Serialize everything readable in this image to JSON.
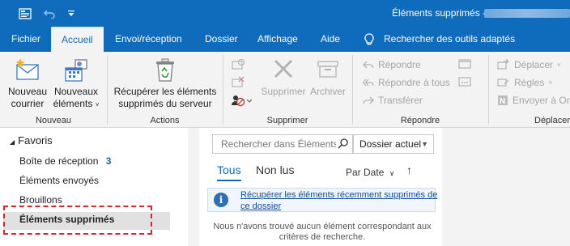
{
  "titlebar": {
    "title": "Éléments supprimés - ",
    "icons": [
      "outlook-sync-icon",
      "undo-icon",
      "qat-customize-icon"
    ]
  },
  "tabs": [
    {
      "label": "Fichier"
    },
    {
      "label": "Accueil",
      "active": true
    },
    {
      "label": "Envoi/réception"
    },
    {
      "label": "Dossier"
    },
    {
      "label": "Affichage"
    },
    {
      "label": "Aide"
    }
  ],
  "tell_me": {
    "label": "Rechercher des outils adaptés",
    "icon": "lightbulb-icon"
  },
  "ribbon": {
    "nouveau": {
      "new_mail": "Nouveau\ncourrier",
      "new_items": "Nouveaux\néléments",
      "group_label": "Nouveau"
    },
    "actions": {
      "recover": "Récupérer les éléments\nsupprimés du serveur",
      "group_label": "Actions"
    },
    "supprimer": {
      "delete": "Supprimer",
      "archive": "Archiver",
      "group_label": "Supprimer"
    },
    "repondre": {
      "reply": "Répondre",
      "reply_all": "Répondre à tous",
      "forward": "Transférer",
      "group_label": "Répondre"
    },
    "deplacer": {
      "move": "Déplacer",
      "rules": "Règles",
      "send_onenote": "Envoyer à On",
      "group_label": "Déplacer"
    }
  },
  "nav": {
    "header": "Favoris",
    "items": [
      {
        "label": "Boîte de réception",
        "count": "3"
      },
      {
        "label": "Éléments envoyés"
      },
      {
        "label": "Brouillons"
      },
      {
        "label": "Éléments supprimés",
        "selected": true
      }
    ]
  },
  "list": {
    "search_placeholder": "Rechercher dans Éléments su",
    "scope": "Dossier actuel",
    "tab_all": "Tous",
    "tab_unread": "Non lus",
    "sort": "Par Date",
    "info_link": "Récupérer les éléments récemment supprimés de ce dossier",
    "empty_message": "Nous n'avons trouvé aucun élément correspondant aux critères de recherche."
  },
  "colors": {
    "accent": "#0f6cbd",
    "highlight_border": "#d6262b",
    "count": "#0f6cbd"
  }
}
